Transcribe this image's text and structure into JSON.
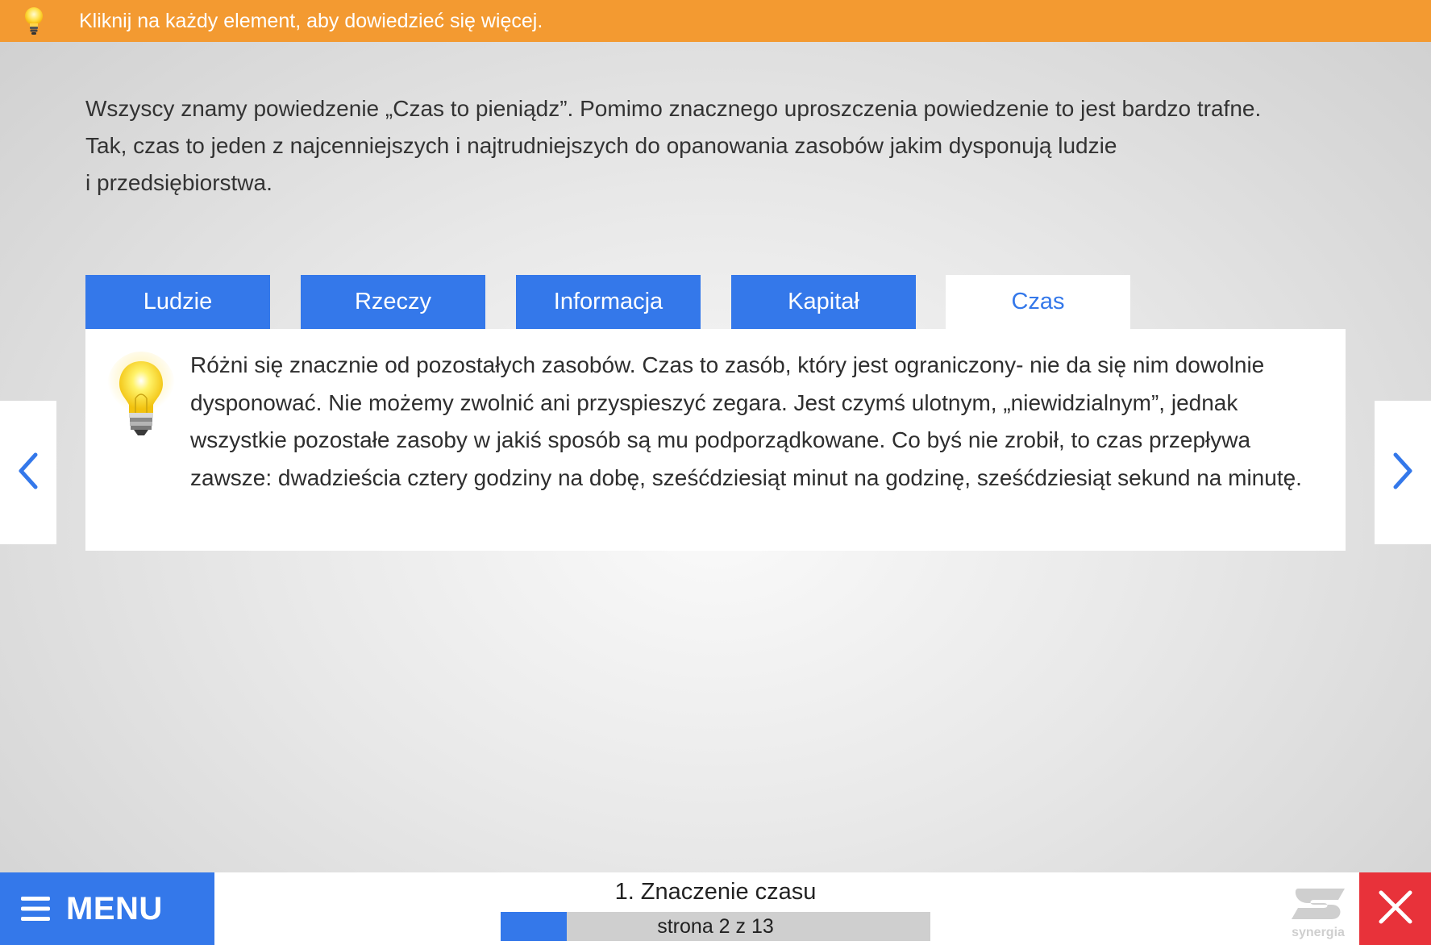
{
  "hint_bar": {
    "icon": "lightbulb-icon",
    "text": "Kliknij na każdy element, aby dowiedzieć się więcej.",
    "color": "#f39a31"
  },
  "intro": {
    "line1": "Wszyscy znamy powiedzenie „Czas to pieniądz”. Pomimo znacznego uproszczenia powiedzenie to jest bardzo trafne.",
    "line2": "Tak, czas to jeden z najcenniejszych i najtrudniejszych do opanowania zasobów jakim dysponują ludzie",
    "line3": "i przedsiębiorstwa."
  },
  "tabs": [
    {
      "label": "Ludzie",
      "active": false
    },
    {
      "label": "Rzeczy",
      "active": false
    },
    {
      "label": "Informacja",
      "active": false
    },
    {
      "label": "Kapitał",
      "active": false
    },
    {
      "label": "Czas",
      "active": true
    }
  ],
  "panel": {
    "icon": "lightbulb-icon",
    "text": "Różni się znacznie od pozostałych zasobów. Czas to zasób, który jest ograniczony- nie da się nim dowolnie dysponować. Nie możemy zwolnić ani przyspieszyć zegara. Jest czymś ulotnym, „niewidzialnym”, jednak wszystkie pozostałe zasoby w jakiś sposób są mu podporządkowane. Co byś nie zrobił, to czas przepływa zawsze: dwadzieścia cztery godziny na dobę, sześćdziesiąt minut na godzinę, sześćdziesiąt sekund na minutę."
  },
  "navigation": {
    "prev_icon": "chevron-left-icon",
    "next_icon": "chevron-right-icon"
  },
  "footer": {
    "menu_label": "MENU",
    "chapter_title": "1. Znaczenie czasu",
    "page_text": "strona 2 z 13",
    "progress_fraction": 0.154,
    "logo_text": "synergia",
    "close_icon": "close-icon"
  },
  "colors": {
    "accent_blue": "#3478ea",
    "close_red": "#e8323a",
    "hint_orange": "#f39a31"
  }
}
